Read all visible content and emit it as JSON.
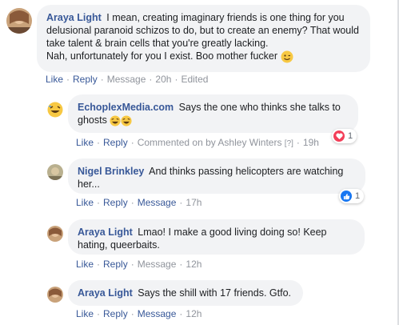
{
  "comments": [
    {
      "author": "Araya Light",
      "text": "I mean, creating imaginary friends is one thing for you delusional paranoid schizos to do, but to create an enemy? That would take talent & brain cells that you're greatly lacking.",
      "text2": "Nah, unfortunately for you I exist. Boo mother fucker",
      "like": "Like",
      "reply": "Reply",
      "message": "Message",
      "time": "20h",
      "edited": "Edited"
    },
    {
      "author": "EchoplexMedia.com",
      "text": "Says the one who thinks she talks to ghosts",
      "like": "Like",
      "reply": "Reply",
      "commented_on_by": "Commented on by Ashley Winters",
      "info_mark": "[?]",
      "time": "19h",
      "reaction": {
        "type": "love",
        "count": "1"
      }
    },
    {
      "author": "Nigel Brinkley",
      "text": "And thinks passing helicopters are watching her...",
      "like": "Like",
      "reply": "Reply",
      "message": "Message",
      "time": "17h",
      "reaction": {
        "type": "like",
        "count": "1"
      }
    },
    {
      "author": "Araya Light",
      "text": "Lmao! I make a good living doing so! Keep hating, queerbaits.",
      "like": "Like",
      "reply": "Reply",
      "message": "Message",
      "time": "12h"
    },
    {
      "author": "Araya Light",
      "text": "Says the shill with 17 friends. Gtfo.",
      "like": "Like",
      "reply": "Reply",
      "message": "Message",
      "time": "12h"
    }
  ],
  "colors": {
    "link": "#385898",
    "meta": "#90949c",
    "bubble": "#f2f3f5",
    "love": "#f33e58",
    "like": "#1877f2"
  },
  "icons": {
    "wink": "wink-emoji-icon",
    "laugh": "laughing-emoji-icon",
    "love": "heart-reaction-icon",
    "like": "thumbs-up-reaction-icon"
  }
}
